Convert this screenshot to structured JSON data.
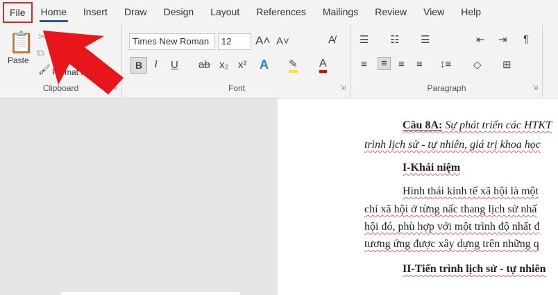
{
  "tabs": [
    "File",
    "Home",
    "Insert",
    "Draw",
    "Design",
    "Layout",
    "References",
    "Mailings",
    "Review",
    "View",
    "Help"
  ],
  "active_tab": "Home",
  "clipboard": {
    "paste": "Paste",
    "format_painter": "Format Painter",
    "label": "Clipboard"
  },
  "font": {
    "name": "Times New Roman",
    "size": "12",
    "label": "Font",
    "bold": "B",
    "italic": "I",
    "underline": "U",
    "subscript": "x₂",
    "superscript": "x²"
  },
  "paragraph": {
    "label": "Paragraph"
  },
  "annotation": {
    "arrow_color": "#e8151b",
    "highlight": "File"
  },
  "document": {
    "q_label": "Câu 8A:",
    "q_text": " Sự phát triển các HTKT",
    "q_line2": "trình lịch sử - tự nhiên, giá trị khoa học",
    "h1": "I-Khái niệm",
    "p1": [
      "Hình thái kinh tế xã hội là một",
      "chỉ xã hội ở từng nấc thang lịch sử nhấ",
      "hội đó, phù hợp với một trình độ nhất đ",
      "tương ứng được xây dựng trên những q"
    ],
    "h2": "II-Tiến trình lịch sử - tự nhiên"
  }
}
